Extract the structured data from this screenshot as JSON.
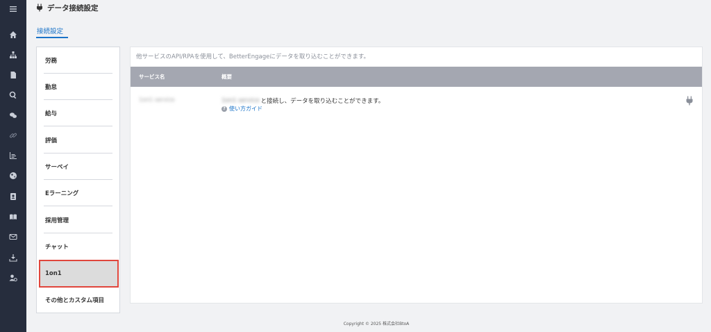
{
  "header": {
    "title": "データ接続設定",
    "icon": "plug-icon"
  },
  "tabs": [
    {
      "label": "接続設定",
      "active": true
    }
  ],
  "categories": [
    {
      "label": "労務"
    },
    {
      "label": "勤怠"
    },
    {
      "label": "給与"
    },
    {
      "label": "評価"
    },
    {
      "label": "サーベイ"
    },
    {
      "label": "Eラーニング"
    },
    {
      "label": "採用管理"
    },
    {
      "label": "チャット"
    },
    {
      "label": "1on1",
      "selected": true
    },
    {
      "label": "その他とカスタム項目"
    }
  ],
  "main": {
    "description": "他サービスのAPI/RPAを使用して、BetterEngageにデータを取り込むことができます。",
    "columns": [
      "サービス名",
      "概要"
    ],
    "rows": [
      {
        "service_name": "1on1 service",
        "summary_blurred": "1on1 service",
        "summary": "と接続し、データを取り込むことができます。",
        "guide_link": "使い方ガイド"
      }
    ]
  },
  "sidebar_icons": [
    "menu-icon",
    "home-icon",
    "org-chart-icon",
    "document-icon",
    "search-icon",
    "chat-icon",
    "link-icon",
    "chart-icon",
    "globe-icon",
    "contact-icon",
    "book-icon",
    "mail-icon",
    "download-icon",
    "user-settings-icon"
  ],
  "footer": {
    "text": "Copyright © 2025 株式会社BtoA"
  },
  "colors": {
    "sidebar_bg": "#262d3d",
    "accent": "#1a73c8",
    "table_header": "#a4a7b1",
    "highlight": "#e0453b"
  }
}
